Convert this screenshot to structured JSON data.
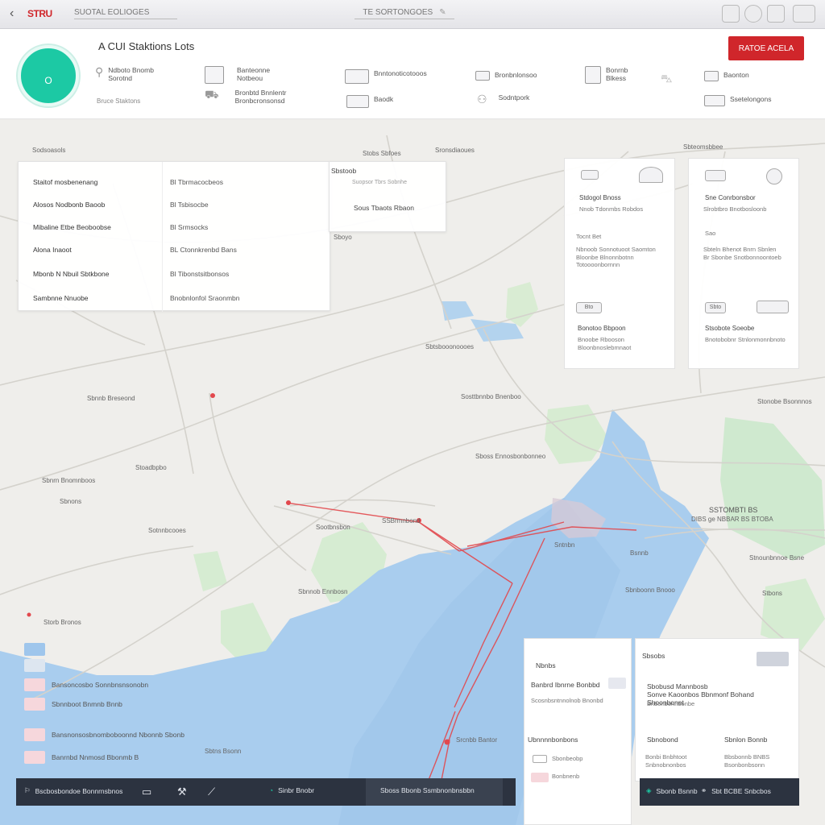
{
  "chrome": {
    "back_icon": "chevron-left-icon",
    "brand": "STRU",
    "tab_address": "SUOTAL EOLIOGES",
    "tab_title": "TE SORTONGOES"
  },
  "header": {
    "avatar_sub": "",
    "avatar_letter": "O",
    "title": "A CUI Staktions Lots",
    "subtitle": "Bruce Staktons",
    "cta": "RATOE ACELA",
    "items": [
      {
        "icon": "location-pin-icon",
        "text": "Ndboto Bnomb Sorotnd"
      },
      {
        "icon": "monitor-icon",
        "text": "Banteonne Notbeou"
      },
      {
        "icon": "truck-icon",
        "text": "Bronbtd Bnnlentr Bronbcronsonsd"
      },
      {
        "icon": "document-icon",
        "text": "Bnntonoticotooos"
      },
      {
        "icon": "chart-icon",
        "text": "Baodk"
      },
      {
        "icon": "card-icon",
        "text": "Bronbnlonsoo"
      },
      {
        "icon": "people-icon",
        "text": "Sodntpork"
      },
      {
        "icon": "image-icon",
        "text": "Bonrnb Blkess"
      },
      {
        "icon": "car-icon",
        "text": ""
      },
      {
        "icon": "laptop-icon",
        "text": "Baonton"
      },
      {
        "icon": "calendar-icon",
        "text": "Ssetelongons"
      }
    ]
  },
  "details": {
    "rows": [
      {
        "key": "Staitof mosbenenang",
        "value": "Bl Tbrmacocbeos"
      },
      {
        "key": "Alosos Nodbonb Baoob",
        "value": "Bl Tsbisocbe"
      },
      {
        "key": "Mibaline Etbe Beoboobse",
        "value": "Bl Srmsocks"
      },
      {
        "key": "Alona Inaoot",
        "value": "BL Ctonnkrenbd Bans"
      },
      {
        "key": "Mbonb N Nbuil Sbtkbone",
        "value": "Bl Tibonstsitbonsos"
      },
      {
        "key": "Sambnne Nnuobe",
        "value": "Bnobnlonfol Sraonmbn"
      }
    ],
    "popup_title": "Sbstoob",
    "popup_sub": "Suopsor Tbrs Sobnhe",
    "popup_text": "Sous Tbaots Rbaon"
  },
  "cards": [
    {
      "icon1": "car-icon",
      "icon2": "warning-icon",
      "title": "Stdogol Bnoss",
      "sub": "Nnob Tdonmbs Robdos",
      "line1": "Tocnt Bet",
      "line2": "Nbnoob Sonnotuoot Saomton Bloonbe Blnonnbotnn Totoooonbornnn",
      "tag": "Bto",
      "footer_t": "Bonotoo Bbpoon",
      "footer_s": "Bnoobe Rbooson Bloonbnoslebmnaot"
    },
    {
      "icon1": "image-icon",
      "icon2": "info-icon",
      "title": "Sne Conrbonsbor",
      "sub": "Slrobtbro Bnotbosloonb",
      "line1": "Sao",
      "line2": "Sbteln Bhenot Bnrn Sbnlen Br Sbonbe Snotbonnoontoeb",
      "tag": "Sbto",
      "footer_t": "Stsobote Soeobe",
      "footer_s": "Bnotobobnr Stnlonmonnbnoto"
    }
  ],
  "map_labels": [
    {
      "text": "Sodsoasols"
    },
    {
      "text": "Sronsdiaoues"
    },
    {
      "text": "Stobs Sbfoes"
    },
    {
      "text": "Sbteomsbbee"
    },
    {
      "text": "Sboyo"
    },
    {
      "text": "Sbtsbooonoooes"
    },
    {
      "text": "Sbnnb Breseond"
    },
    {
      "text": "Sosttbnnbo Bnenboo"
    },
    {
      "text": "Stonobe Bsonnnos"
    },
    {
      "text": "Sboss Ennosbonbonneo"
    },
    {
      "text": "Stoadbpbo"
    },
    {
      "text": "Sbnrn Bnomnboos"
    },
    {
      "text": "Sotnnbcooes"
    },
    {
      "text": "Sootbnsbon"
    },
    {
      "text": "SSBrmnbond"
    },
    {
      "text": "Sntnbn"
    },
    {
      "text": "Stnounbnnoe Bsne"
    },
    {
      "text": "Sbnnob Ennbosn"
    },
    {
      "text": "Storb Bronos"
    },
    {
      "text": "Sbnboonn Bnooo"
    },
    {
      "text": "Sbtns Bsonn"
    },
    {
      "text": "SSTOMBTI BS"
    },
    {
      "text": "DIBS ge NBBAR BS BTOBA"
    },
    {
      "text": "Srcnbb Bantor"
    },
    {
      "text": "Bsnnb"
    },
    {
      "text": "Sbnons"
    },
    {
      "text": "Stbons"
    }
  ],
  "legend": [
    {
      "color": "#9fc6ec",
      "text": ""
    },
    {
      "color": "#dde6f0",
      "text": ""
    },
    {
      "color": "#f6d7dc",
      "text": "Bansoncosbo Sonnbnsnsonobn"
    },
    {
      "color": "#f6d7dc",
      "text": "Sbnnboot Bnmnb Bnnb"
    },
    {
      "color": "#f6d7dc",
      "text": "Bansnonsosbnomboboonnd Nbonnb Sbonb"
    },
    {
      "color": "#f6d7dc",
      "text": "Banrnbd Nnmosd Bbonmb B"
    }
  ],
  "info": {
    "left": {
      "title": "Nbnbs",
      "t1": "Banbrd Ibnrne Bonbbd",
      "s1": "Scosnbsntnnolnob Bnonbd",
      "section": "Ubnnnnbonbons",
      "s2": "Sbonbeobp",
      "s3": "Bonbnenb"
    },
    "right": {
      "title": "Sbsobs",
      "t1": "Sbobusd Mannbosb",
      "t2": "Sonve Kaoonbos Bbnmonf Bohand Shoonbonet",
      "s1": "Bnbonbonnbonbe",
      "c1": "Sbnobond",
      "c2": "Sbnlon Bonnb",
      "c3": "Bonbi Bnbhtoot Snbnobnonbos",
      "c4": "Bbsbonnb BNBS Bsonbonbsonn"
    }
  },
  "bottombar_left": [
    {
      "icon": "flag-icon",
      "text": "Bscbosbondoe Bonnrnsbnos"
    },
    {
      "icon": "monitor-icon",
      "text": ""
    },
    {
      "icon": "tool-icon",
      "text": ""
    },
    {
      "icon": "road-icon",
      "text": ""
    },
    {
      "icon": "wifi-icon",
      "text": "Sinbr Bnobr"
    },
    {
      "icon": "",
      "text": "Sboss Bbonb Ssmbnonbnsbbn"
    }
  ],
  "bottombar_right": [
    {
      "icon": "logo-icon",
      "text": "Sbonb Bsnnb"
    },
    {
      "icon": "link-icon",
      "text": "Sbt BCBE Snbcbos"
    }
  ],
  "colors": {
    "accent": "#d0262b",
    "avatar": "#1cc9a4",
    "water": "#a9cdee",
    "park": "#cfe8cf",
    "route": "#e2484d",
    "bar": "#2c3340"
  }
}
